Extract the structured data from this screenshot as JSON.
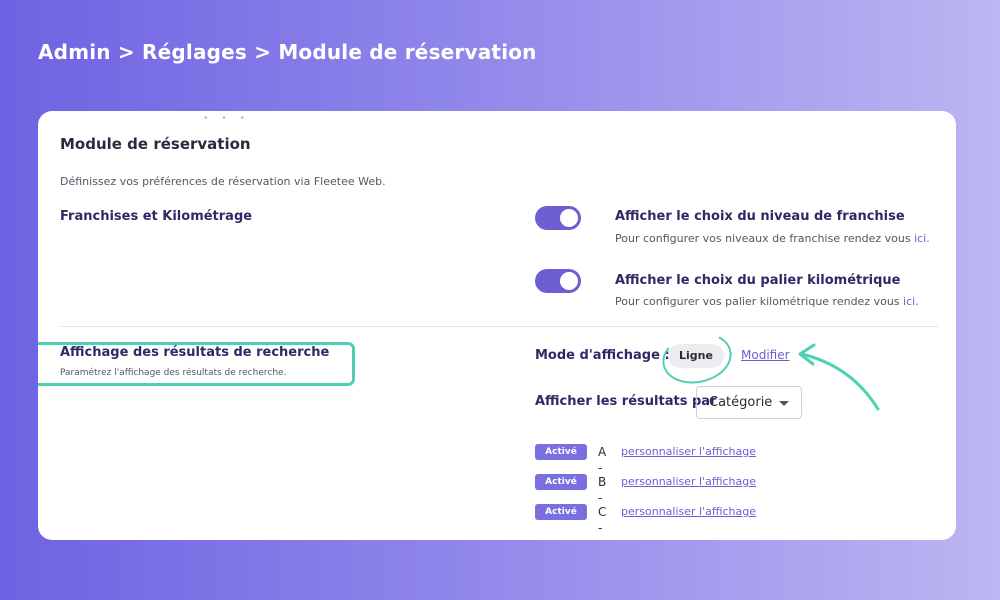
{
  "breadcrumb": "Admin > Réglages > Module de réservation",
  "card": {
    "title": "Module de réservation",
    "description": "Définissez vos préférences de réservation via Fleetee Web.",
    "franchise_section": {
      "label": "Franchises et Kilométrage",
      "options": [
        {
          "title": "Afficher le choix du niveau de franchise",
          "subtitle": "Pour configurer vos niveaux de franchise rendez vous",
          "link": "ici.",
          "enabled": true
        },
        {
          "title": "Afficher le choix du palier kilométrique",
          "subtitle": "Pour configurer vos palier kilométrique rendez vous",
          "link": "ici.",
          "enabled": true
        }
      ]
    },
    "search_results": {
      "title": "Affichage des résultats de recherche",
      "subtitle": "Paramétrez l'affichage des résultats de recherche.",
      "mode_label": "Mode d'affichage :",
      "mode_value": "Ligne",
      "modify_label": "Modifier",
      "group_label": "Afficher les résultats par",
      "group_value": "Catégorie",
      "categories": [
        {
          "badge": "Activé",
          "letter": "A -",
          "link": "personnaliser l'affichage"
        },
        {
          "badge": "Activé",
          "letter": "B -",
          "link": "personnaliser l'affichage"
        },
        {
          "badge": "Activé",
          "letter": "C -",
          "link": "personnaliser l'affichage"
        }
      ]
    }
  },
  "colors": {
    "accent": "#6b5fd3",
    "highlight": "#4fcfb4",
    "background_start": "#6e62e2",
    "background_end": "#bcb6f2"
  }
}
